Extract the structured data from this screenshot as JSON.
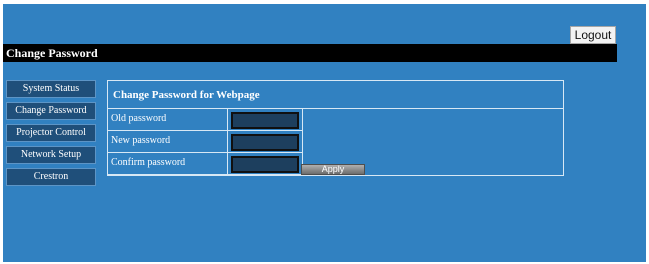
{
  "header": {
    "logout_label": "Logout",
    "page_title": "Change Password"
  },
  "sidebar": {
    "items": [
      {
        "label": "System Status"
      },
      {
        "label": "Change Password"
      },
      {
        "label": "Projector Control"
      },
      {
        "label": "Network Setup"
      },
      {
        "label": "Crestron"
      }
    ]
  },
  "form": {
    "title": "Change Password for Webpage",
    "fields": [
      {
        "label": "Old password",
        "value": ""
      },
      {
        "label": "New password",
        "value": ""
      },
      {
        "label": "Confirm password",
        "value": ""
      }
    ],
    "apply_label": "Apply"
  },
  "colors": {
    "background": "#3181c1",
    "title_bar": "#000000",
    "nav_button": "#1f4f7a",
    "input_fill": "#1d3f5e"
  }
}
